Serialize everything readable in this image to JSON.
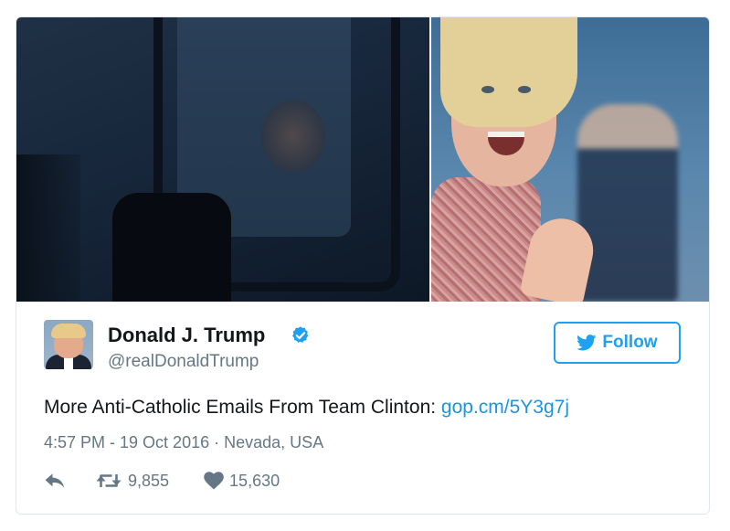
{
  "tweet": {
    "author_name": "Donald J. Trump",
    "author_handle": "@realDonaldTrump",
    "verified": true,
    "follow_label": "Follow",
    "text": "More Anti-Catholic Emails From Team Clinton: ",
    "link_text": "gop.cm/5Y3g7j",
    "time": "4:57 PM - 19 Oct 2016",
    "location_separator": "·",
    "location": "Nevada, USA",
    "retweets": "9,855",
    "likes": "15,630"
  },
  "icons": {
    "verified": "verified-badge-icon",
    "bird": "twitter-bird-icon",
    "reply": "reply-icon",
    "retweet": "retweet-icon",
    "like": "heart-icon"
  },
  "colors": {
    "accent": "#1da1f2",
    "link": "#1b95e0",
    "text": "#14171a",
    "muted": "#657786",
    "border": "#e1e8ed"
  }
}
